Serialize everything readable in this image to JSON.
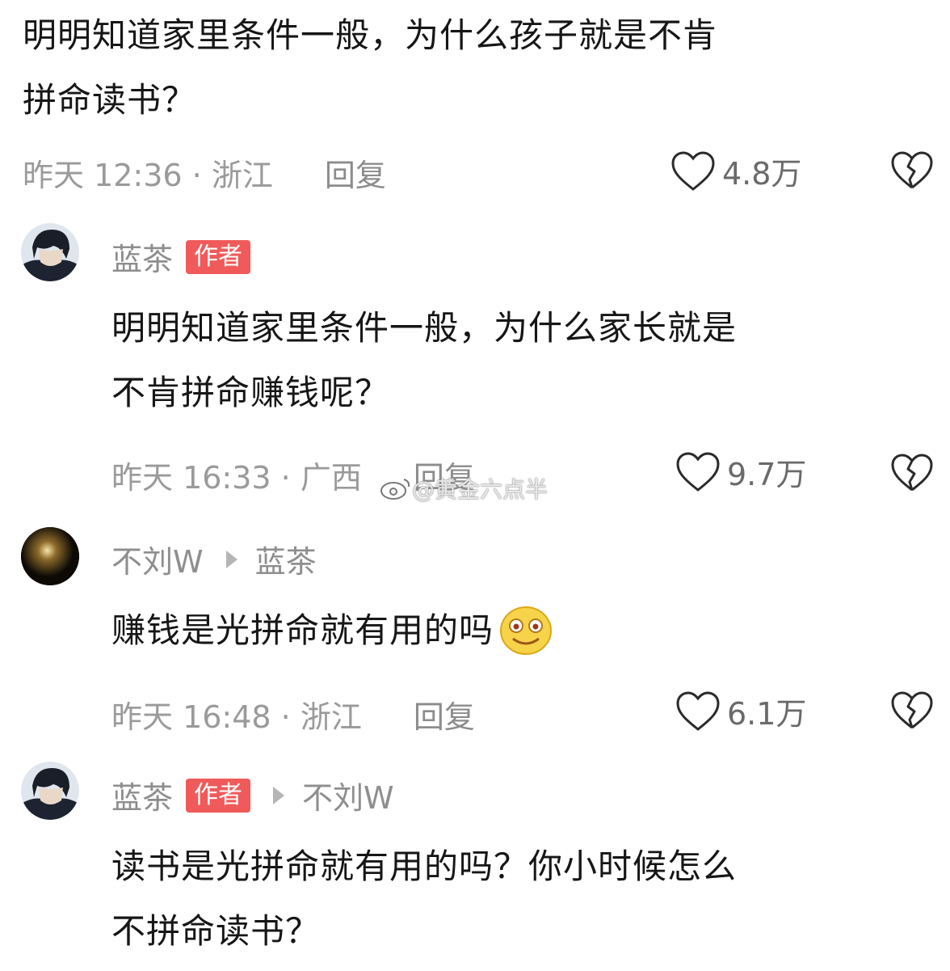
{
  "comments": [
    {
      "text_lines": [
        "明明知道家里条件一般，为什么孩子就是不肯",
        "拼命读书？"
      ],
      "meta": "昨天 12:36 · 浙江",
      "reply": "回复",
      "likes": "4.8万"
    },
    {
      "user": "蓝茶",
      "badge": "作者",
      "text_lines": [
        "明明知道家里条件一般，为什么家长就是",
        "不肯拼命赚钱呢？"
      ],
      "meta": "昨天 16:33 · 广西",
      "reply": "回复",
      "likes": "9.7万"
    },
    {
      "user": "不刘W",
      "reply_to": "蓝茶",
      "text_lines": [
        "赚钱是光拼命就有用的吗"
      ],
      "emoji": "smiley-emoji",
      "meta": "昨天 16:48 · 浙江",
      "reply": "回复",
      "likes": "6.1万"
    },
    {
      "user": "蓝茶",
      "badge": "作者",
      "reply_to": "不刘W",
      "text_lines": [
        "读书是光拼命就有用的吗？你小时候怎么",
        "不拼命读书？"
      ]
    }
  ],
  "watermark": "@黄金六点半",
  "icons": {
    "like": "heart-outline-icon",
    "dislike": "broken-heart-icon",
    "reply_arrow": "triangle-right-icon"
  },
  "colors": {
    "badge": "#f05a5a",
    "meta": "#9a9a9a"
  }
}
